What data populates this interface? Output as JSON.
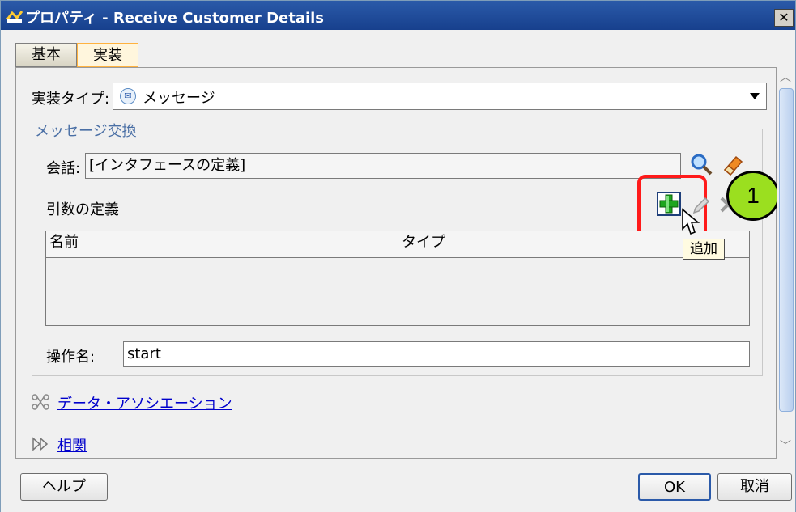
{
  "window": {
    "title": "プロパティ - Receive Customer Details",
    "close_glyph": "✕"
  },
  "tabs": [
    {
      "label": "基本"
    },
    {
      "label": "実装"
    }
  ],
  "impl_type": {
    "label": "実装タイプ:",
    "value": "メッセージ",
    "icon": "envelope-icon"
  },
  "message_exchange": {
    "legend": "メッセージ交換",
    "conversation_label": "会話:",
    "conversation_value": "[インタフェースの定義]",
    "arguments_label": "引数の定義",
    "table_headers": [
      "名前",
      "タイプ"
    ],
    "add_tooltip": "追加",
    "operation_label": "操作名:",
    "operation_value": "start"
  },
  "annotation": {
    "step_number": "1",
    "highlight_color": "#ff1a1a",
    "badge_color": "#9bdf1f"
  },
  "links": {
    "data_association": "データ・アソシエーション",
    "correlation": "相関"
  },
  "buttons": {
    "help": "ヘルプ",
    "ok": "OK",
    "cancel": "取消"
  }
}
